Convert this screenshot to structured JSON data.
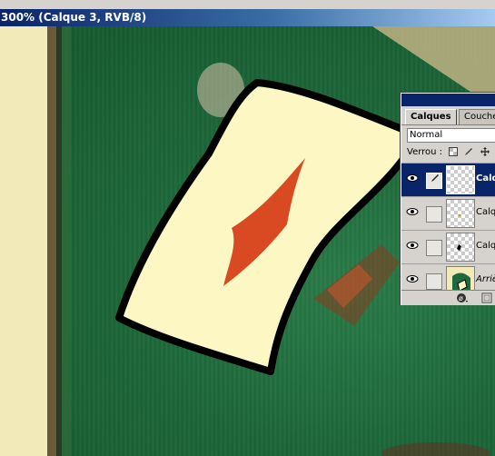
{
  "window": {
    "caption": "300% (Calque 3, RVB/8)"
  },
  "layers_palette": {
    "tabs": [
      {
        "label": "Calques",
        "active": true
      },
      {
        "label": "Couche",
        "active": false
      }
    ],
    "blend_mode": "Normal",
    "lock_label": "Verrou :",
    "lock_icons": [
      "lock-transparency-icon",
      "lock-paint-icon",
      "lock-move-icon"
    ],
    "layers": [
      {
        "name": "Calq",
        "selected": true,
        "visible": true
      },
      {
        "name": "Calq",
        "selected": false,
        "visible": true
      },
      {
        "name": "Calq",
        "selected": false,
        "visible": true
      },
      {
        "name": "Arriè",
        "selected": false,
        "visible": true
      }
    ],
    "footer_icons": [
      "layer-effects-icon",
      "new-layer-icon"
    ]
  },
  "colors": {
    "felt_green": "#1e6a3c",
    "card_fill": "#fdf7c4",
    "diamond_red": "#d94a22",
    "selection_blue": "#0a246a"
  }
}
